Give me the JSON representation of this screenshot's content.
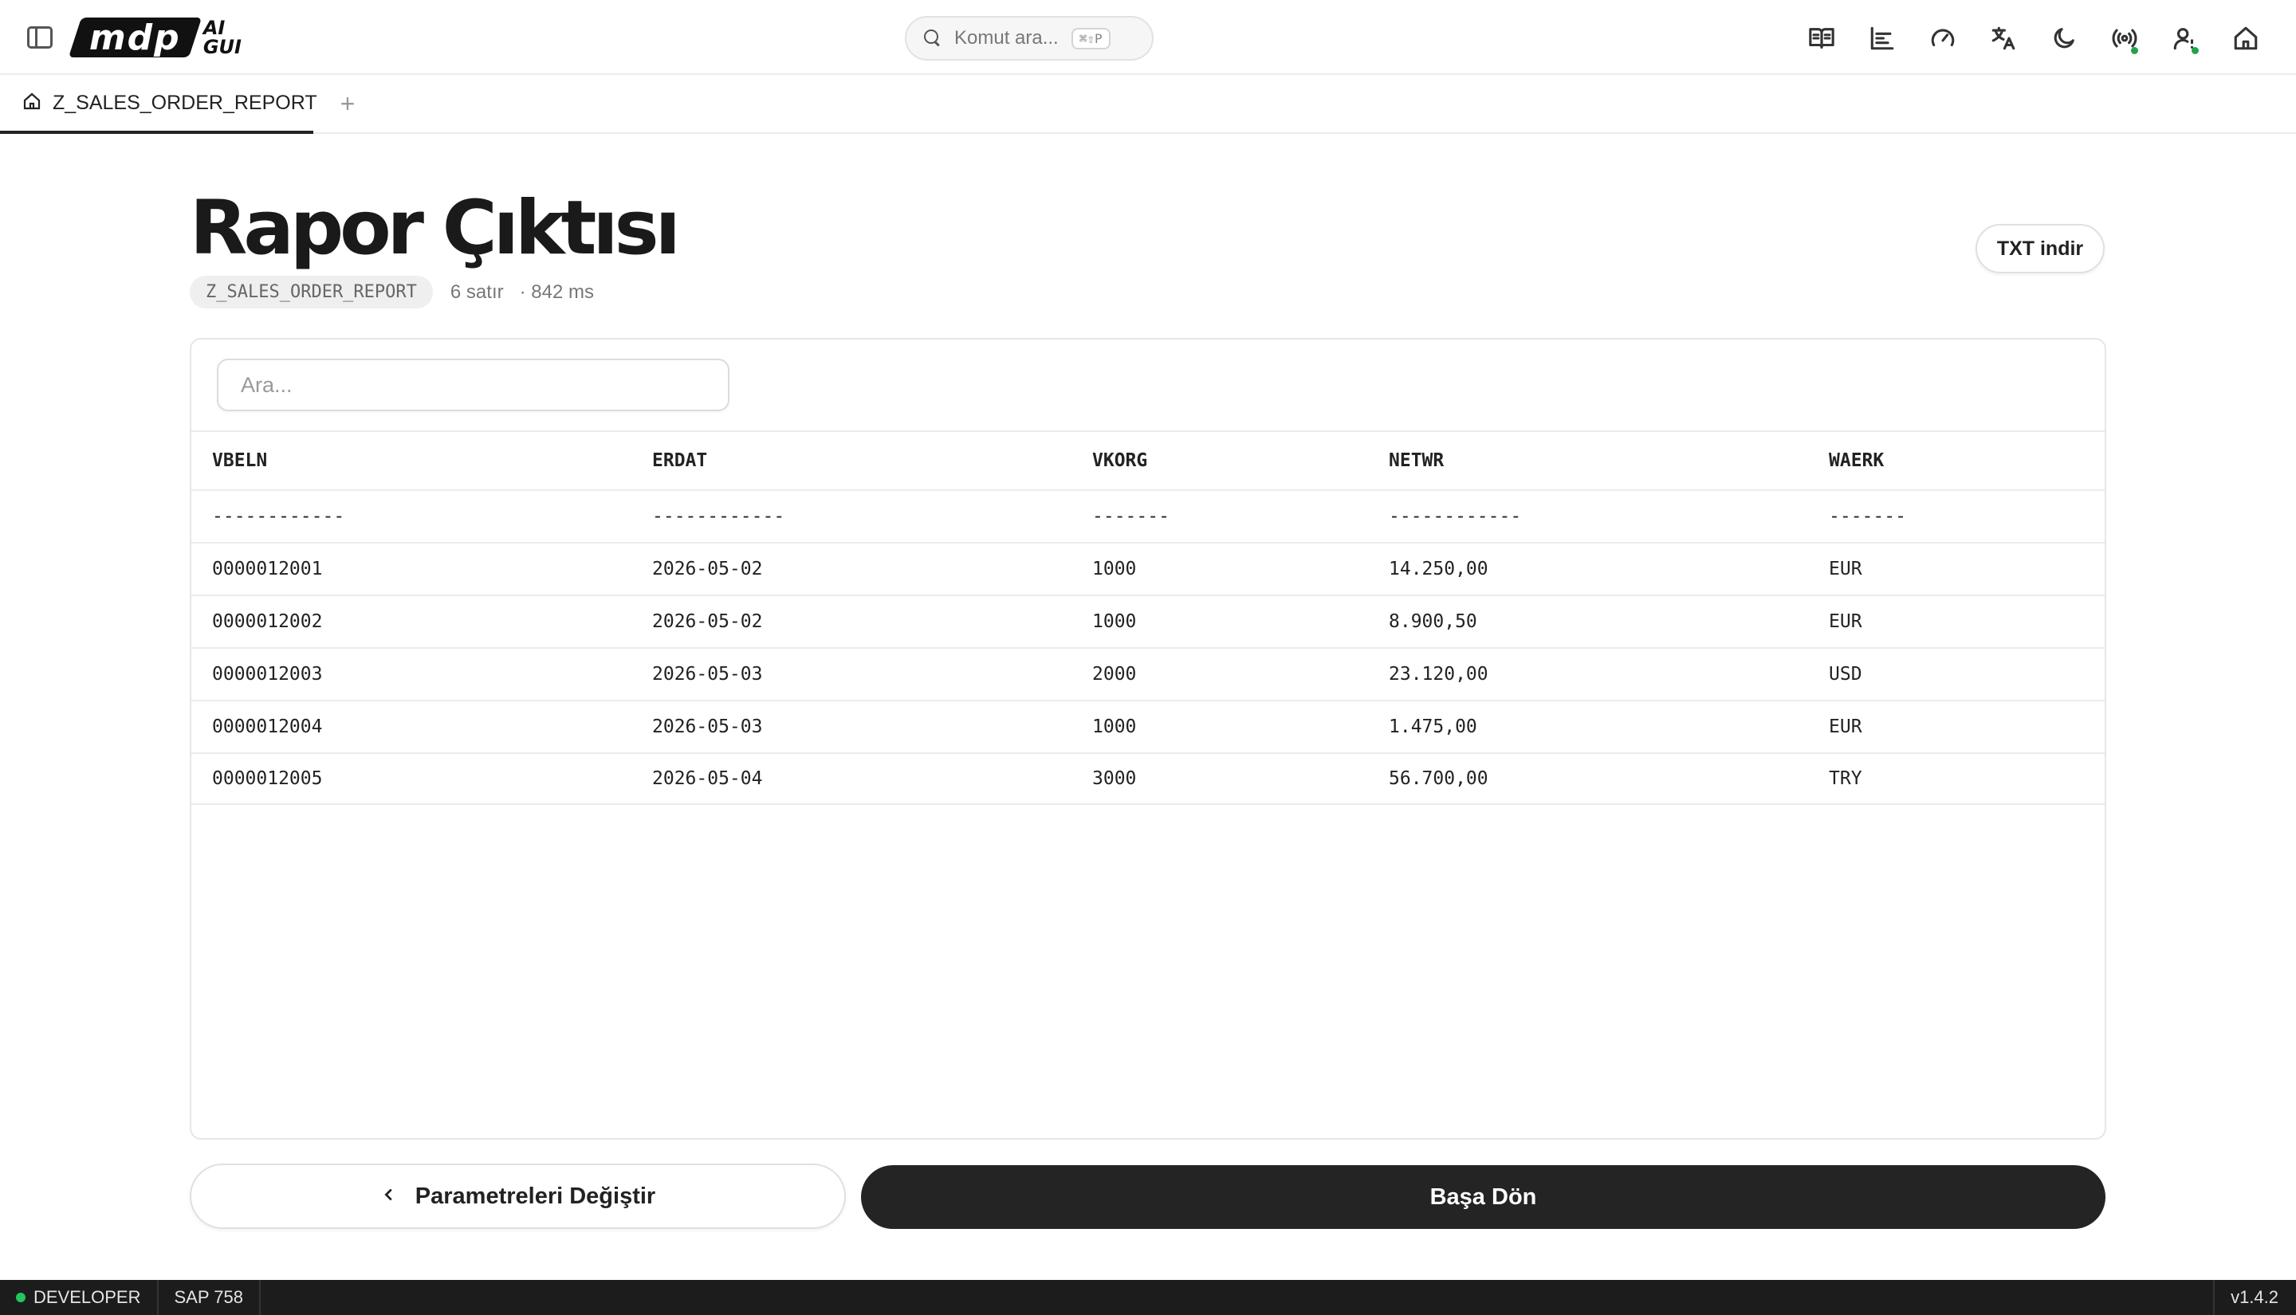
{
  "app": {
    "logo": {
      "mark": "mdp",
      "ai": "AI",
      "gui": "GUI"
    }
  },
  "topbar": {
    "command_search": {
      "placeholder": "Komut ara...",
      "shortcut": "⌘⇧P"
    },
    "icons": [
      "book-open-icon",
      "chart-icon",
      "gauge-icon",
      "translate-icon",
      "moon-icon",
      "broadcast-icon",
      "user-settings-icon",
      "home-icon"
    ],
    "status_dot_color": "#22a34a"
  },
  "tabs": [
    {
      "label": "Z_SALES_ORDER_REPORT",
      "icon": "home-icon",
      "active": true
    }
  ],
  "tab_add_label": "+",
  "report": {
    "title": "Rapor Çıktısı",
    "program": "Z_SALES_ORDER_REPORT",
    "row_count": "6 satır",
    "duration": "· 842 ms",
    "download_label": "TXT indir",
    "search_placeholder": "Ara...",
    "columns": [
      "VBELN",
      "ERDAT",
      "VKORG",
      "NETWR",
      "WAERK"
    ],
    "rows": [
      [
        "------------",
        "------------",
        "-------",
        "------------",
        "-------"
      ],
      [
        "0000012001",
        "2026-05-02",
        "1000",
        "14.250,00",
        "EUR"
      ],
      [
        "0000012002",
        "2026-05-02",
        "1000",
        "8.900,50",
        "EUR"
      ],
      [
        "0000012003",
        "2026-05-03",
        "2000",
        "23.120,00",
        "USD"
      ],
      [
        "0000012004",
        "2026-05-03",
        "1000",
        "1.475,00",
        "EUR"
      ],
      [
        "0000012005",
        "2026-05-04",
        "3000",
        "56.700,00",
        "TRY"
      ]
    ]
  },
  "actions": {
    "change_params": "Parametreleri Değiştir",
    "back_home": "Başa Dön"
  },
  "statusbar": {
    "environment": "DEVELOPER",
    "system": "SAP 758",
    "version": "v1.4.2",
    "environment_color": "#22c55e"
  }
}
